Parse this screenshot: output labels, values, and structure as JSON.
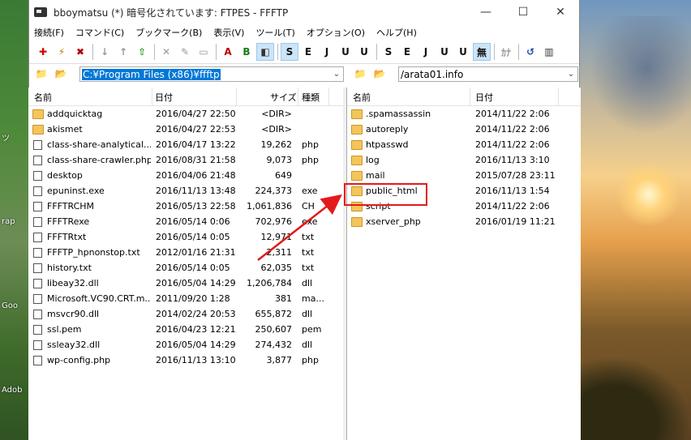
{
  "window": {
    "title": "bboymatsu (*) 暗号化されています: FTPES - FFFTP",
    "min_glyph": "—",
    "max_glyph": "☐",
    "close_glyph": "✕"
  },
  "desktop": {
    "labels": [
      "ツ",
      "rap",
      "Goo",
      "Adob"
    ]
  },
  "menu": [
    "接続(F)",
    "コマンド(C)",
    "ブックマーク(B)",
    "表示(V)",
    "ツール(T)",
    "オプション(O)",
    "ヘルプ(H)"
  ],
  "toolbar": {
    "buttons": [
      {
        "name": "connect-icon",
        "glyph": "✚",
        "color": "#d00000"
      },
      {
        "name": "quick-connect-icon",
        "glyph": "⚡",
        "color": "#b08000"
      },
      {
        "name": "disconnect-icon",
        "glyph": "✖",
        "color": "#b00000"
      },
      {
        "name": "download-icon",
        "glyph": "↓",
        "color": "#999999"
      },
      {
        "name": "upload-icon",
        "glyph": "↑",
        "color": "#999999"
      },
      {
        "name": "mirror-upload-icon",
        "glyph": "⇧",
        "color": "#2a9a2a"
      },
      {
        "name": "delete-icon",
        "glyph": "✕",
        "color": "#999999"
      },
      {
        "name": "rename-icon",
        "glyph": "✎",
        "color": "#999999"
      },
      {
        "name": "mkdir-icon",
        "glyph": "▭",
        "color": "#999999"
      },
      {
        "name": "ascii-mode-icon",
        "glyph": "A",
        "color": "#c00000"
      },
      {
        "name": "binary-mode-icon",
        "glyph": "B",
        "color": "#1a7a1a"
      },
      {
        "name": "auto-mode-icon",
        "glyph": "◧",
        "color": "#333333",
        "selected": true
      },
      {
        "name": "host-sjis-icon",
        "glyph": "S",
        "color": "#111111",
        "selected": true
      },
      {
        "name": "host-euc-icon",
        "glyph": "E",
        "color": "#111111"
      },
      {
        "name": "host-jis-icon",
        "glyph": "J",
        "color": "#111111"
      },
      {
        "name": "host-utf8-icon",
        "glyph": "U",
        "color": "#111111"
      },
      {
        "name": "host-utf8bom-icon",
        "glyph": "U",
        "color": "#111111"
      },
      {
        "name": "local-sjis-icon",
        "glyph": "S",
        "color": "#111111"
      },
      {
        "name": "local-euc-icon",
        "glyph": "E",
        "color": "#111111"
      },
      {
        "name": "local-jis-icon",
        "glyph": "J",
        "color": "#111111"
      },
      {
        "name": "local-utf8-icon",
        "glyph": "U",
        "color": "#111111"
      },
      {
        "name": "local-utf8bom-icon",
        "glyph": "U",
        "color": "#111111"
      },
      {
        "name": "no-convert-icon",
        "glyph": "無",
        "color": "#111111",
        "selected": true
      },
      {
        "name": "kana-convert-icon",
        "glyph": "ｶﾅ",
        "color": "#999999"
      },
      {
        "name": "refresh-icon",
        "glyph": "↺",
        "color": "#1a4fb0"
      },
      {
        "name": "list-view-icon",
        "glyph": "▥",
        "color": "#333333"
      }
    ]
  },
  "local": {
    "path": "C:¥Program Files (x86)¥ffftp",
    "columns": {
      "name": "名前",
      "date": "日付",
      "size": "サイズ",
      "type": "種類"
    },
    "files": [
      {
        "name": "addquicktag",
        "date": "2016/04/27 22:50",
        "size": "<DIR>",
        "type": "",
        "folder": true
      },
      {
        "name": "akismet",
        "date": "2016/04/27 22:53",
        "size": "<DIR>",
        "type": "",
        "folder": true
      },
      {
        "name": "class-share-analytical...",
        "date": "2016/04/17 13:22",
        "size": "19,262",
        "type": "php"
      },
      {
        "name": "class-share-crawler.php",
        "date": "2016/08/31 21:58",
        "size": "9,073",
        "type": "php"
      },
      {
        "name": "desktop",
        "date": "2016/04/06 21:48",
        "size": "649",
        "type": ""
      },
      {
        "name": "epuninst.exe",
        "date": "2016/11/13 13:48",
        "size": "224,373",
        "type": "exe"
      },
      {
        "name": "FFFTRCHM",
        "date": "2016/05/13 22:58",
        "size": "1,061,836",
        "type": "CH"
      },
      {
        "name": "FFFTRexe",
        "date": "2016/05/14  0:06",
        "size": "702,976",
        "type": "exe"
      },
      {
        "name": "FFFTRtxt",
        "date": "2016/05/14  0:05",
        "size": "12,971",
        "type": "txt"
      },
      {
        "name": "FFFTP_hpnonstop.txt",
        "date": "2012/01/16 21:31",
        "size": "2,311",
        "type": "txt"
      },
      {
        "name": "history.txt",
        "date": "2016/05/14  0:05",
        "size": "62,035",
        "type": "txt"
      },
      {
        "name": "libeay32.dll",
        "date": "2016/05/04 14:29",
        "size": "1,206,784",
        "type": "dll"
      },
      {
        "name": "Microsoft.VC90.CRT.m...",
        "date": "2011/09/20  1:28",
        "size": "381",
        "type": "ma..."
      },
      {
        "name": "msvcr90.dll",
        "date": "2014/02/24 20:53",
        "size": "655,872",
        "type": "dll"
      },
      {
        "name": "ssl.pem",
        "date": "2016/04/23 12:21",
        "size": "250,607",
        "type": "pem"
      },
      {
        "name": "ssleay32.dll",
        "date": "2016/05/04 14:29",
        "size": "274,432",
        "type": "dll"
      },
      {
        "name": "wp-config.php",
        "date": "2016/11/13 13:10",
        "size": "3,877",
        "type": "php"
      }
    ]
  },
  "remote": {
    "path": "/arata01.info",
    "columns": {
      "name": "名前",
      "date": "日付"
    },
    "files": [
      {
        "name": ".spamassassin",
        "date": "2014/11/22  2:06"
      },
      {
        "name": "autoreply",
        "date": "2014/11/22  2:06"
      },
      {
        "name": "htpasswd",
        "date": "2014/11/22  2:06"
      },
      {
        "name": "log",
        "date": "2016/11/13  3:10"
      },
      {
        "name": "mail",
        "date": "2015/07/28 23:11"
      },
      {
        "name": "public_html",
        "date": "2016/11/13  1:54",
        "highlight": true
      },
      {
        "name": "script",
        "date": "2014/11/22  2:06"
      },
      {
        "name": "xserver_php",
        "date": "2016/01/19 11:21"
      }
    ]
  },
  "annotation_color": "#e3191c"
}
